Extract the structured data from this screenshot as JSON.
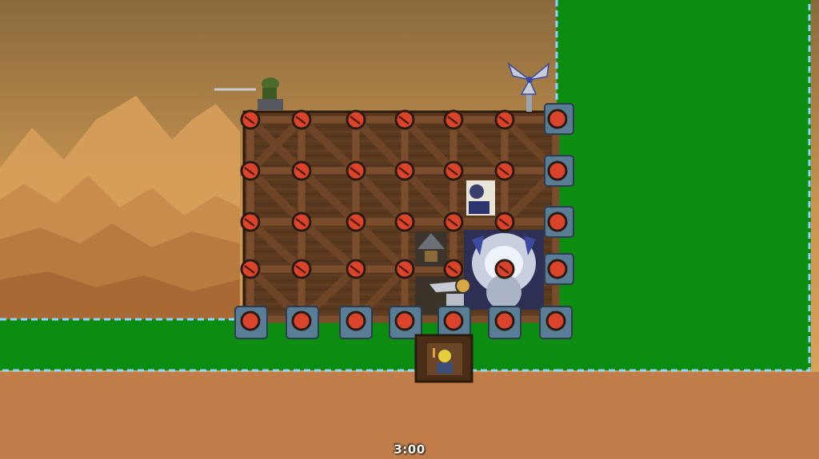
{
  "hud": {
    "match_timer": "3:00"
  },
  "colors": {
    "sky_top": "#a9793f",
    "sky_bottom": "#d9a45d",
    "ground": "#c07d49",
    "build_zone": "#0c8c11",
    "zone_border": "#8fd3ff",
    "wood": "#5e3b20",
    "strut": "#7a4e2c",
    "bolt": "#d9442b",
    "foundation": "#5a7d96"
  },
  "icons": [
    "sniper-soldier-icon",
    "wind-turbine-icon",
    "cannon-weapon-icon",
    "metal-mine-icon",
    "reactor-core-icon",
    "workshop-icon",
    "miner-icon"
  ]
}
